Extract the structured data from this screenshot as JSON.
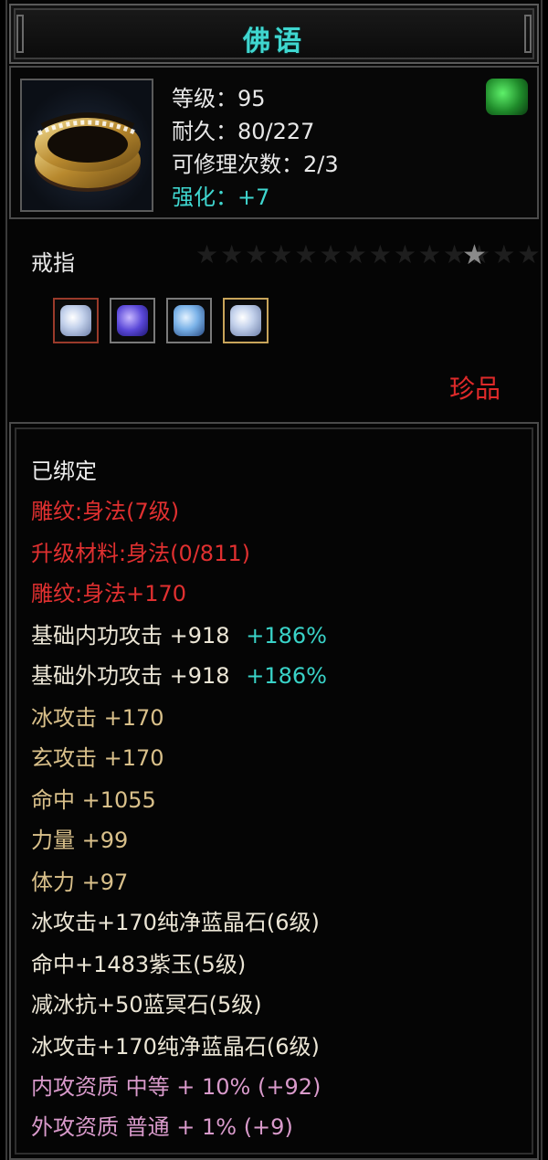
{
  "title": "佛语",
  "header": {
    "level": "等级：95",
    "durability": "耐久：80/227",
    "repairs": "可修理次数：2/3",
    "enhance": "强化：+7"
  },
  "icons": {
    "item": "ring-icon",
    "badge": "green-dragon-badge-icon",
    "gems": [
      "white-diamond-gem-icon",
      "purple-gem-icon",
      "blue-crystal-gem-icon",
      "white-diamond-gem-icon"
    ]
  },
  "item_type": "戒指",
  "stars": "★★★★★★★★★★★★★★",
  "star_lit": "★",
  "quality": "珍品",
  "attributes": {
    "bound": "已绑定",
    "engrave": "雕纹:身法(7级)",
    "upgrade": "升级材料:身法(0/811)",
    "engrave_bonus": "雕纹:身法+170",
    "inner_base": "基础内功攻击  +918",
    "inner_pct": "+186%",
    "outer_base": "基础外功攻击  +918",
    "outer_pct": "+186%",
    "ice_atk": "冰攻击  +170",
    "mystic_atk": "玄攻击  +170",
    "hit": "命中  +1055",
    "strength": "力量  +99",
    "stamina": "体力  +97",
    "gem1": "冰攻击+170纯净蓝晶石(6级)",
    "gem2": "命中+1483紫玉(5级)",
    "gem3": "减冰抗+50蓝冥石(5级)",
    "gem4": "冰攻击+170纯净蓝晶石(6级)",
    "inner_quality": "内攻资质  中等  +  10%  (+92)",
    "outer_quality": "外攻资质  普通  +  1%  (+9)"
  },
  "colors": {
    "title": "#3fd6cf",
    "red": "#e03030",
    "tan": "#d9c08a",
    "pink": "#d99acb",
    "cyan": "#39d3c8"
  }
}
